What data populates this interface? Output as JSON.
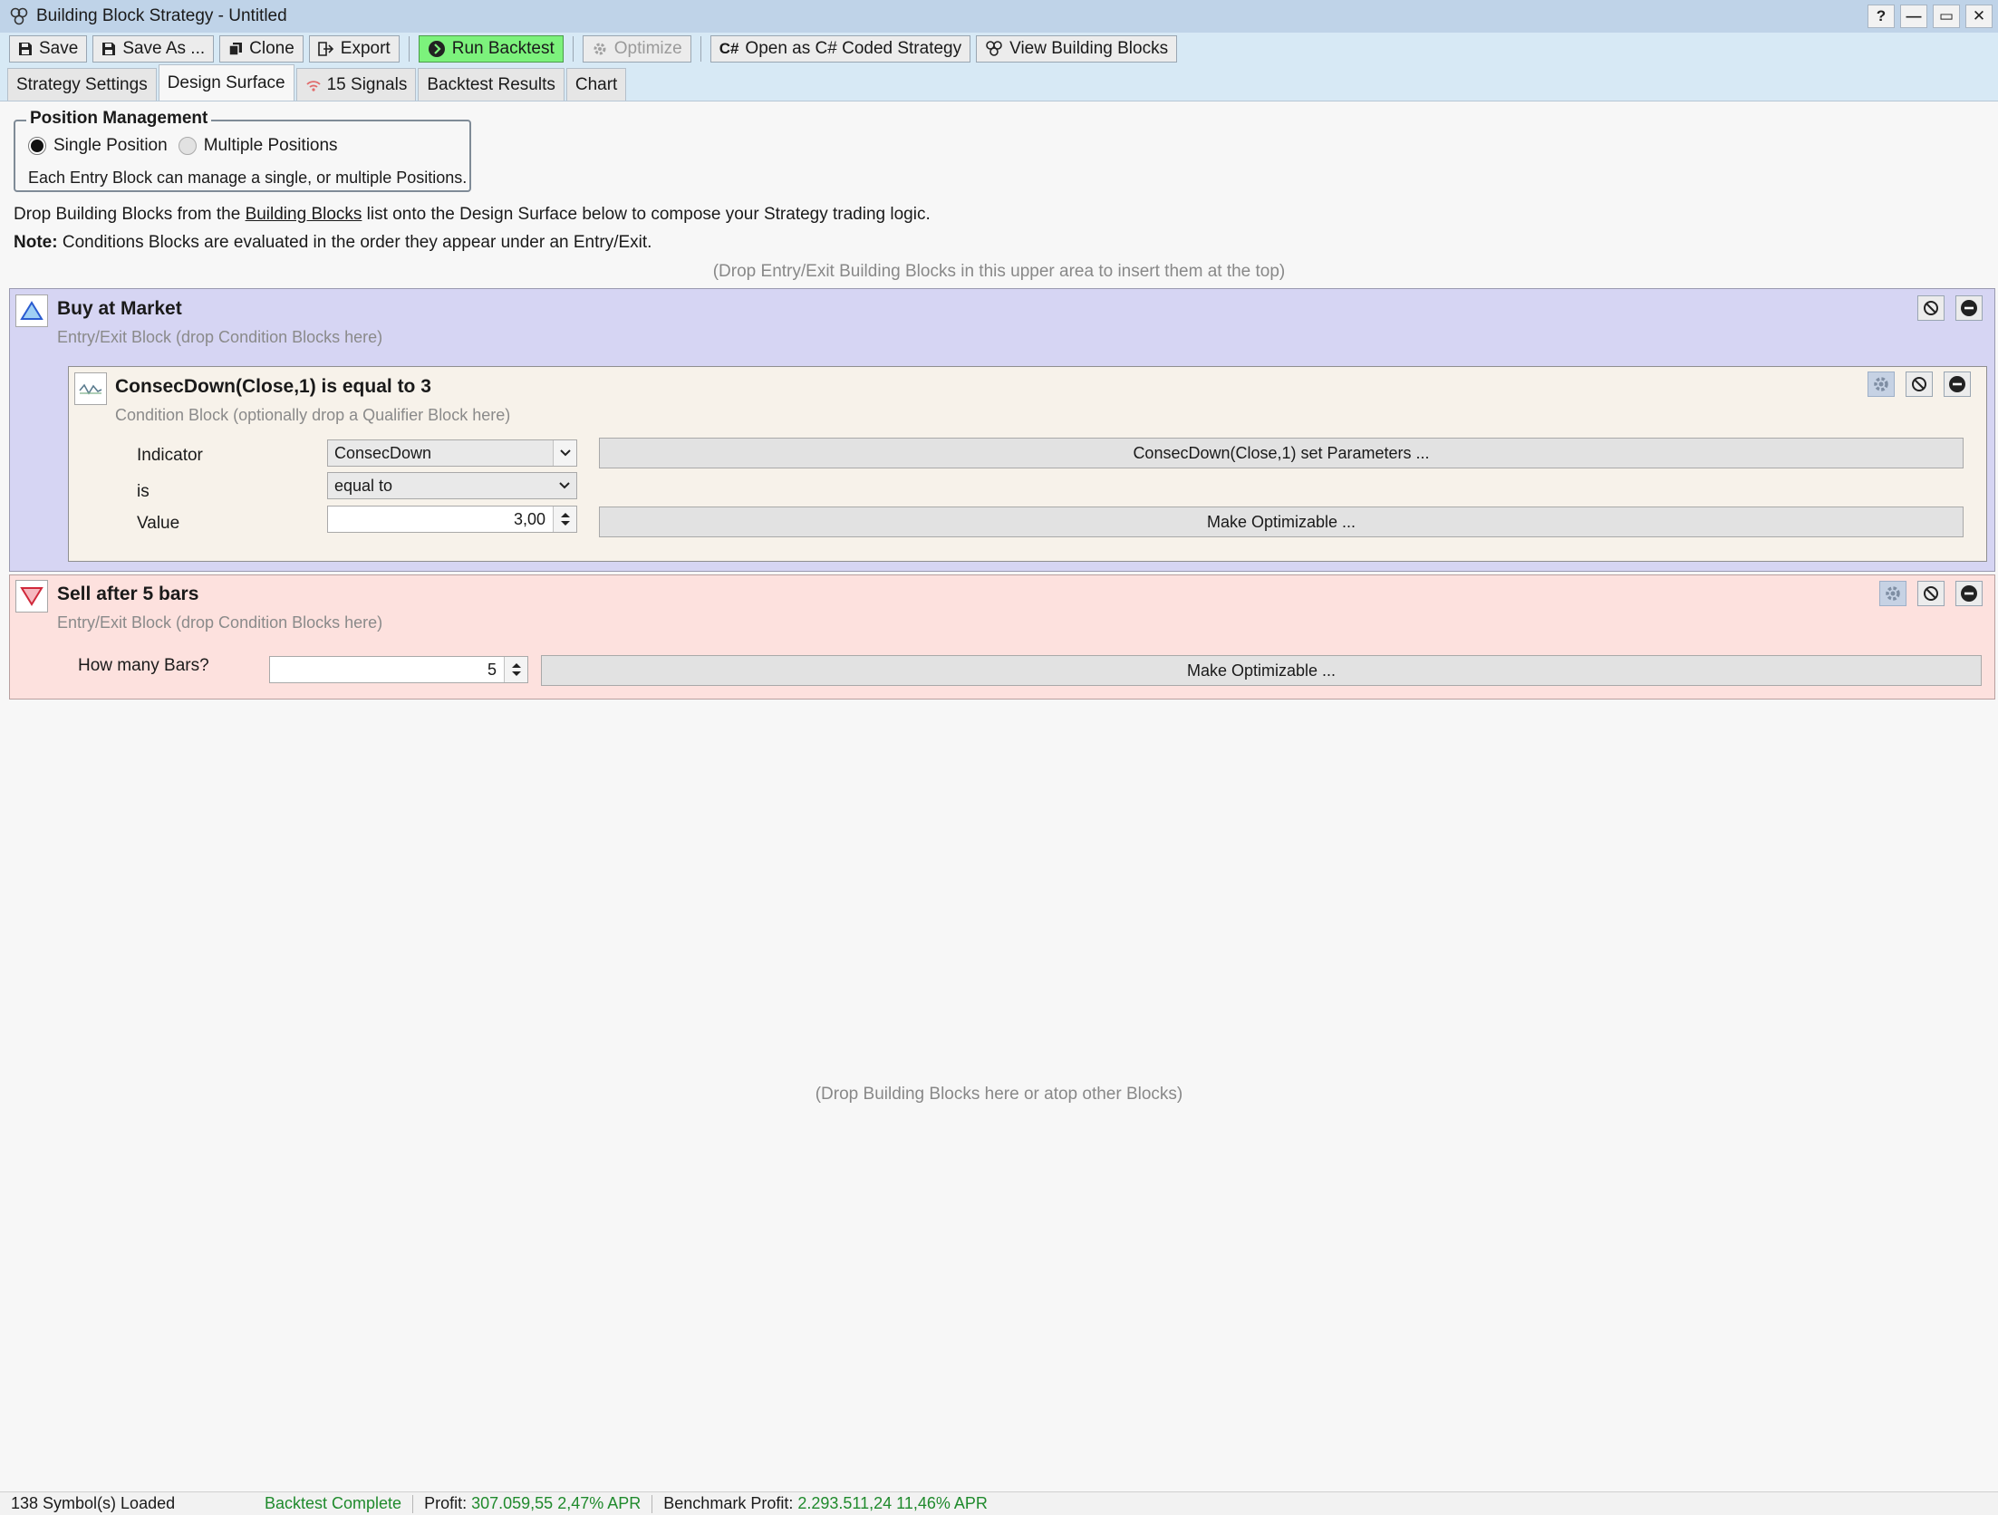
{
  "window": {
    "title": "Building Block Strategy - Untitled",
    "controls": [
      "?",
      "—",
      "▭",
      "✕"
    ]
  },
  "toolbar": {
    "save": "Save",
    "save_as": "Save As ...",
    "clone": "Clone",
    "export": "Export",
    "run_backtest": "Run Backtest",
    "optimize": "Optimize",
    "open_csharp": "Open as C# Coded Strategy",
    "view_blocks": "View Building Blocks",
    "run_color": "#7cf27c"
  },
  "tabs": [
    {
      "label": "Strategy Settings",
      "active": false
    },
    {
      "label": "Design Surface",
      "active": true
    },
    {
      "label": "15 Signals",
      "active": false,
      "icon": "signal-icon"
    },
    {
      "label": "Backtest Results",
      "active": false
    },
    {
      "label": "Chart",
      "active": false
    }
  ],
  "position_management": {
    "legend": "Position Management",
    "single": "Single Position",
    "multiple": "Multiple Positions",
    "selected": "single",
    "description": "Each Entry Block can manage a single, or multiple Positions."
  },
  "info": {
    "line1_pre": "Drop Building Blocks from the ",
    "line1_link": "Building Blocks",
    "line1_post": " list onto the Design Surface below to compose your Strategy trading logic.",
    "note_label": "Note:",
    "note_text": " Conditions Blocks are evaluated in the order they appear under an Entry/Exit."
  },
  "drop_top": "(Drop Entry/Exit Building Blocks in this upper area to insert them at the top)",
  "entry_block": {
    "title": "Buy at Market",
    "subtitle": "Entry/Exit Block (drop Condition Blocks here)",
    "color": "#d6d5f3",
    "condition": {
      "title": "ConsecDown(Close,1) is equal to 3",
      "subtitle": "Condition Block (optionally drop a Qualifier Block here)",
      "indicator_label": "Indicator",
      "indicator_value": "ConsecDown",
      "is_label": "is",
      "is_value": "equal to",
      "value_label": "Value",
      "value": "3,00",
      "params_button": "ConsecDown(Close,1) set Parameters ...",
      "optimize_button": "Make Optimizable ..."
    }
  },
  "exit_block": {
    "title": "Sell after 5 bars",
    "subtitle": "Entry/Exit Block (drop Condition Blocks here)",
    "color": "#fde1de",
    "bars_label": "How many Bars?",
    "bars_value": "5",
    "optimize_button": "Make Optimizable ..."
  },
  "drop_bottom": "(Drop Building Blocks here or atop other Blocks)",
  "status": {
    "symbols": "138 Symbol(s) Loaded",
    "backtest": "Backtest Complete",
    "profit_label": "Profit:",
    "profit_value": "307.059,55",
    "profit_apr": "2,47% APR",
    "bench_label": "Benchmark Profit:",
    "bench_value": "2.293.511,24",
    "bench_apr": "11,46% APR"
  }
}
